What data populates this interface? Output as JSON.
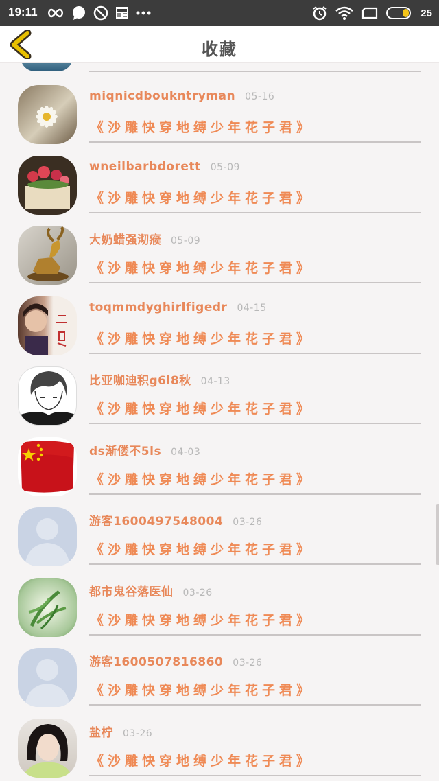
{
  "status_bar": {
    "time": "19:11",
    "battery": "25"
  },
  "header": {
    "title": "收藏"
  },
  "items": [
    {
      "username": "miqnicdboukntryman",
      "date": "05-16",
      "book_title": "《沙雕快穿地缚少年花子君》"
    },
    {
      "username": "wneilbarbdorett",
      "date": "05-09",
      "book_title": "《沙雕快穿地缚少年花子君》"
    },
    {
      "username": "大奶蜡强沏瘊",
      "date": "05-09",
      "book_title": "《沙雕快穿地缚少年花子君》"
    },
    {
      "username": "toqmmdyghirlfigedr",
      "date": "04-15",
      "book_title": "《沙雕快穿地缚少年花子君》"
    },
    {
      "username": "比亚咖迪积g6l8秋",
      "date": "04-13",
      "book_title": "《沙雕快穿地缚少年花子君》"
    },
    {
      "username": "ds渐偻不5ls",
      "date": "04-03",
      "book_title": "《沙雕快穿地缚少年花子君》"
    },
    {
      "username": "游客1600497548004",
      "date": "03-26",
      "book_title": "《沙雕快穿地缚少年花子君》"
    },
    {
      "username": "都市鬼谷落医仙",
      "date": "03-26",
      "book_title": "《沙雕快穿地缚少年花子君》"
    },
    {
      "username": "游客1600507816860",
      "date": "03-26",
      "book_title": "《沙雕快穿地缚少年花子君》"
    },
    {
      "username": "盐柠",
      "date": "03-26",
      "book_title": "《沙雕快穿地缚少年花子君》"
    }
  ],
  "icons": {
    "back": "chevron-left-icon",
    "infinity": "infinity-icon",
    "chat": "chat-bubble-icon",
    "blocked": "do-not-disturb-icon",
    "news": "news-icon",
    "more": "more-icon",
    "alarm": "alarm-icon",
    "wifi": "wifi-icon",
    "screen": "screen-icon",
    "battery": "battery-icon"
  },
  "colors": {
    "accent": "#ef8a55",
    "back_arrow": "#d4a400",
    "date": "#b8b8b8"
  }
}
